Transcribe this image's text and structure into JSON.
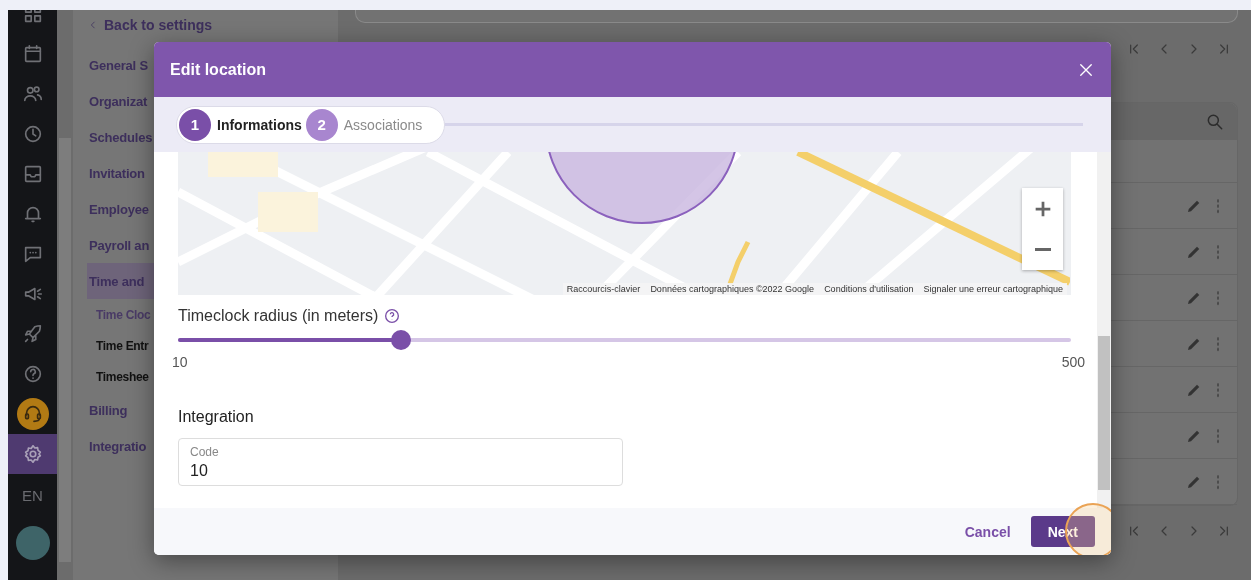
{
  "rail": {
    "items": [
      {
        "selected": false
      },
      {
        "selected": false
      },
      {
        "selected": false
      },
      {
        "selected": false
      },
      {
        "selected": false
      },
      {
        "selected": false
      },
      {
        "selected": false
      },
      {
        "selected": false
      },
      {
        "selected": false
      },
      {
        "selected": false
      },
      {
        "selected": false
      },
      {
        "selected": true
      }
    ],
    "language": "EN"
  },
  "settings_nav": {
    "back_link": "Back to settings",
    "items": [
      {
        "label": "General S",
        "selected": false
      },
      {
        "label": "Organizat",
        "selected": false
      },
      {
        "label": "Schedules",
        "selected": false
      },
      {
        "label": "Invitation",
        "selected": false
      },
      {
        "label": "Employee",
        "selected": false
      },
      {
        "label": "Payroll an",
        "selected": false
      },
      {
        "label": "Time and",
        "selected": true,
        "children": [
          {
            "label": "Time Cloc",
            "selected": true
          },
          {
            "label": "Time Entr",
            "selected": false
          },
          {
            "label": "Timeshee",
            "selected": false
          }
        ]
      },
      {
        "label": "Billing",
        "selected": false
      },
      {
        "label": "Integratio",
        "selected": false
      }
    ]
  },
  "locations_table": {
    "rows": [
      {
        "kind": "action-row"
      },
      {
        "kind": "action-row"
      },
      {
        "kind": "action-row"
      },
      {
        "kind": "action-row"
      },
      {
        "kind": "action-row"
      },
      {
        "kind": "action-row"
      },
      {
        "kind": "action-row"
      }
    ]
  },
  "dialog": {
    "title": "Edit location",
    "steps": [
      {
        "number": "1",
        "label": "Informations",
        "selected": true
      },
      {
        "number": "2",
        "label": "Associations",
        "selected": false
      }
    ],
    "map": {
      "attribution": [
        "Raccourcis-clavier",
        "Données cartographiques ©2022 Google",
        "Conditions d'utilisation",
        "Signaler une erreur cartographique"
      ]
    },
    "radius": {
      "label": "Timeclock radius (in meters)",
      "level": 0.25,
      "min": "10",
      "max": "500"
    },
    "integration": {
      "heading": "Integration",
      "code_field": {
        "label": "Code",
        "value": "10"
      }
    },
    "buttons": [
      {
        "label": "Cancel",
        "kind": "text"
      },
      {
        "label": "Next",
        "kind": "primary"
      }
    ]
  }
}
